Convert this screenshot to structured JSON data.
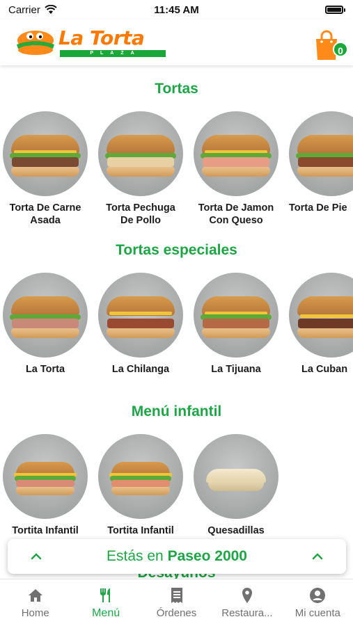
{
  "status_bar": {
    "carrier": "Carrier",
    "time": "11:45 AM"
  },
  "header": {
    "brand_name": "La Torta",
    "brand_sub": "PLAZA",
    "cart_count": "0"
  },
  "colors": {
    "accent_green": "#1fa447",
    "brand_orange": "#ff7a00"
  },
  "sections": [
    {
      "title": "Tortas",
      "items": [
        {
          "name_line1": "Torta De Carne",
          "name_line2": "Asada"
        },
        {
          "name_line1": "Torta Pechuga",
          "name_line2": "De Pollo"
        },
        {
          "name_line1": "Torta De Jamon",
          "name_line2": "Con Queso"
        },
        {
          "name_line1": "Torta De Pie",
          "name_line2": ""
        }
      ]
    },
    {
      "title": "Tortas especiales",
      "items": [
        {
          "name_line1": "La Torta",
          "name_line2": ""
        },
        {
          "name_line1": "La Chilanga",
          "name_line2": ""
        },
        {
          "name_line1": "La Tijuana",
          "name_line2": ""
        },
        {
          "name_line1": "La Cuban",
          "name_line2": ""
        }
      ]
    },
    {
      "title": "Menú infantil",
      "items": [
        {
          "name_line1": "Tortita Infantil",
          "name_line2": ""
        },
        {
          "name_line1": "Tortita Infantil",
          "name_line2": ""
        },
        {
          "name_line1": "Quesadillas",
          "name_line2": ""
        }
      ]
    },
    {
      "title": "Desayunos"
    }
  ],
  "location_bar": {
    "prefix": "Estás en",
    "location": "Paseo 2000"
  },
  "tabs": [
    {
      "label": "Home",
      "icon": "home-icon"
    },
    {
      "label": "Menú",
      "icon": "fork-knife-icon"
    },
    {
      "label": "Órdenes",
      "icon": "receipt-icon"
    },
    {
      "label": "Restaura...",
      "icon": "location-pin-icon"
    },
    {
      "label": "Mi cuenta",
      "icon": "account-icon"
    }
  ]
}
